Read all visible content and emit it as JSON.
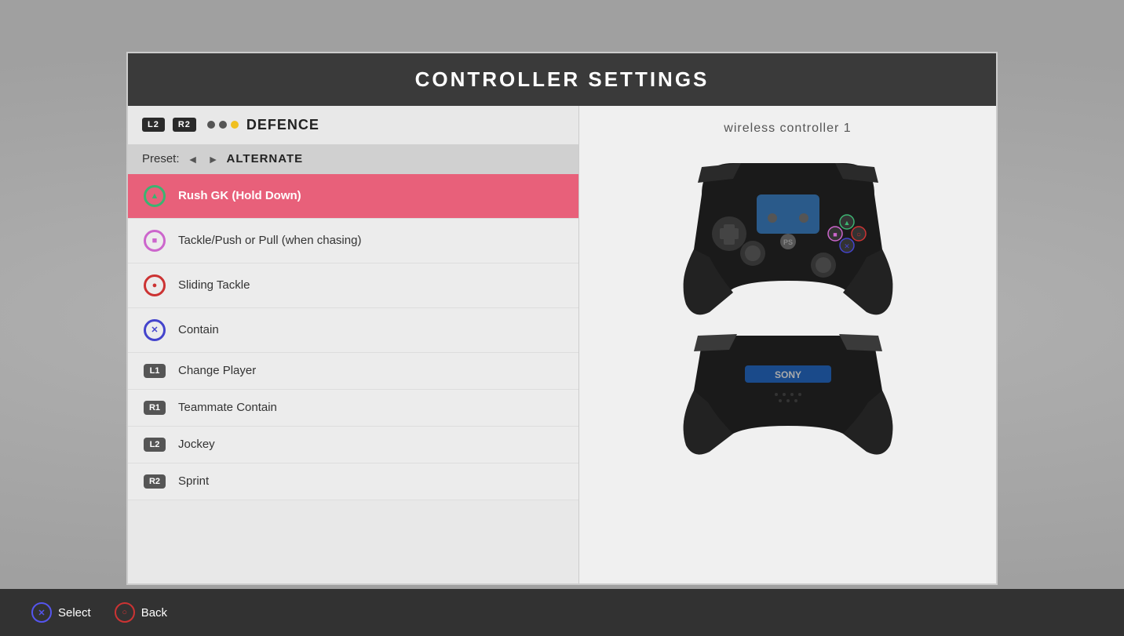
{
  "title": "CONTROLLER SETTINGS",
  "tab": {
    "l2": "L2",
    "r2": "R2",
    "label": "DEFENCE",
    "dots": [
      "inactive",
      "inactive",
      "active"
    ]
  },
  "preset": {
    "label": "Preset:",
    "left_arrow": "◄",
    "right_arrow": "►",
    "value": "ALTERNATE"
  },
  "bindings": [
    {
      "button": "triangle",
      "button_type": "ps",
      "name": "Rush GK (Hold Down)",
      "active": true
    },
    {
      "button": "square",
      "button_type": "ps",
      "name": "Tackle/Push or Pull (when chasing)",
      "active": false
    },
    {
      "button": "circle_r",
      "button_type": "ps",
      "name": "Sliding Tackle",
      "active": false
    },
    {
      "button": "cross",
      "button_type": "ps",
      "name": "Contain",
      "active": false
    },
    {
      "button": "L1",
      "button_type": "trigger",
      "name": "Change Player",
      "active": false
    },
    {
      "button": "R1",
      "button_type": "trigger",
      "name": "Teammate Contain",
      "active": false
    },
    {
      "button": "L2",
      "button_type": "trigger",
      "name": "Jockey",
      "active": false
    },
    {
      "button": "R2",
      "button_type": "trigger",
      "name": "Sprint",
      "active": false
    }
  ],
  "controller": {
    "label": "wireless controller 1"
  },
  "bottom_actions": [
    {
      "icon_type": "cross",
      "label": "Select"
    },
    {
      "icon_type": "circle",
      "label": "Back"
    }
  ]
}
